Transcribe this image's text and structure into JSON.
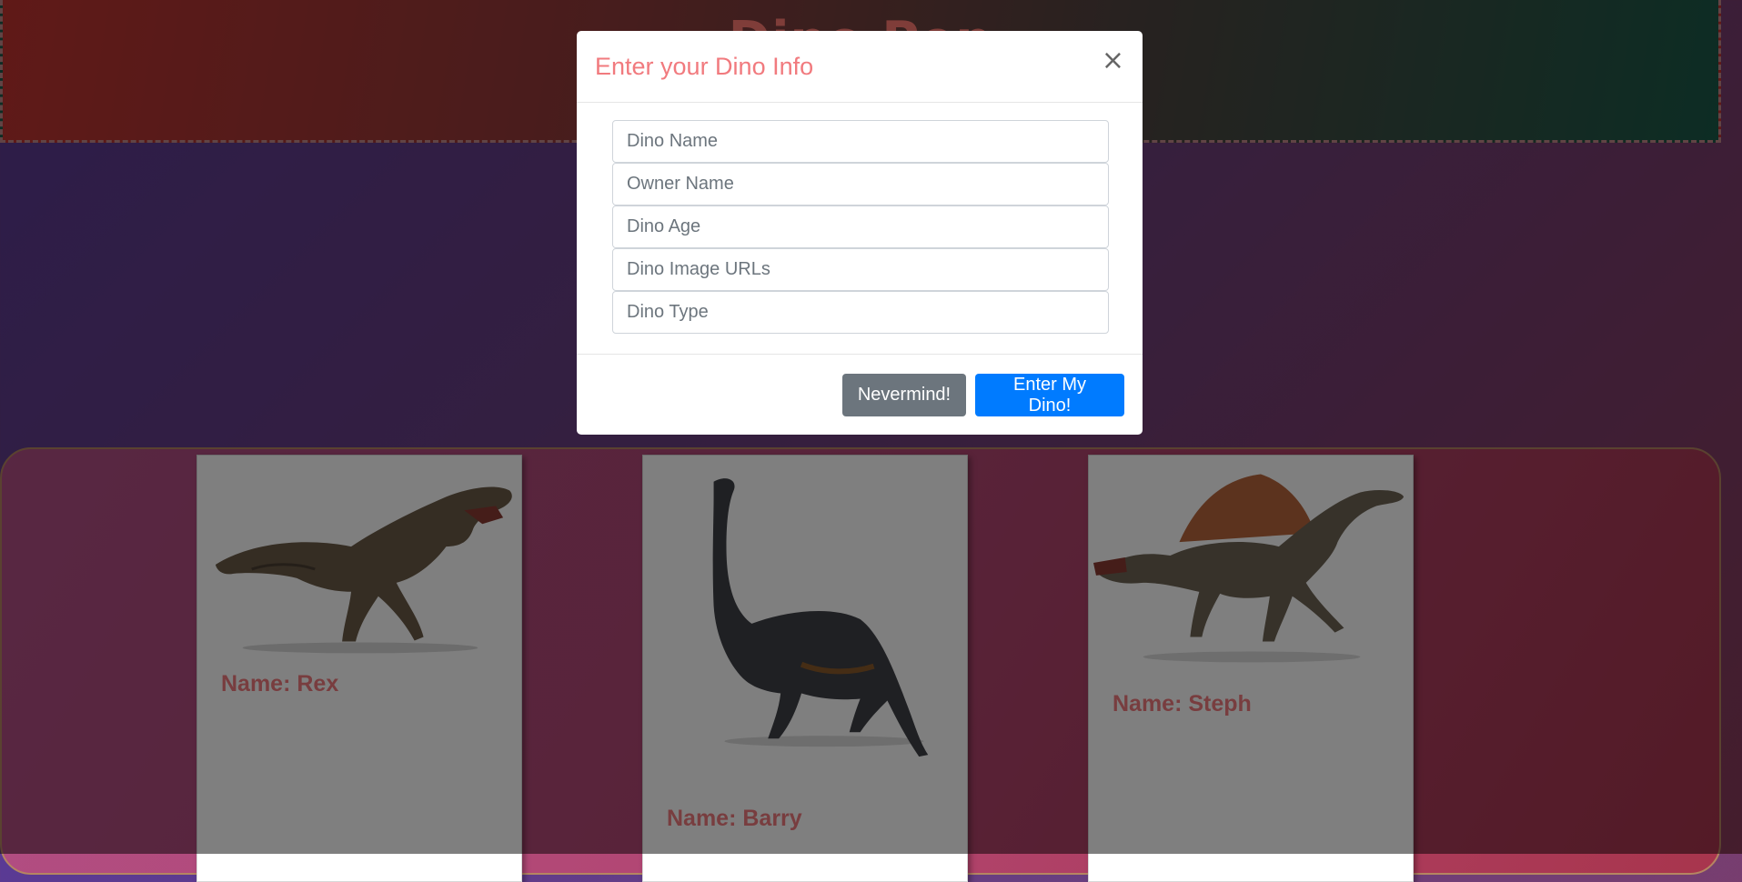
{
  "header": {
    "title": "Dino Pen"
  },
  "cards": [
    {
      "name_label": "Name: Rex",
      "image_icon": "t-rex-image"
    },
    {
      "name_label": "Name: Barry",
      "image_icon": "brontosaurus-image"
    },
    {
      "name_label": "Name: Steph",
      "image_icon": "spinosaurus-image"
    }
  ],
  "modal": {
    "title": "Enter your Dino Info",
    "close_label": "×",
    "fields": {
      "dino_name": "Dino Name",
      "owner_name": "Owner Name",
      "dino_age": "Dino Age",
      "dino_image_urls": "Dino Image URLs",
      "dino_type": "Dino Type"
    },
    "cancel_label": "Nevermind!",
    "submit_label": "Enter My Dino!"
  },
  "colors": {
    "accent": "#f17a7e",
    "primary": "#007bff",
    "secondary": "#6c757d"
  }
}
